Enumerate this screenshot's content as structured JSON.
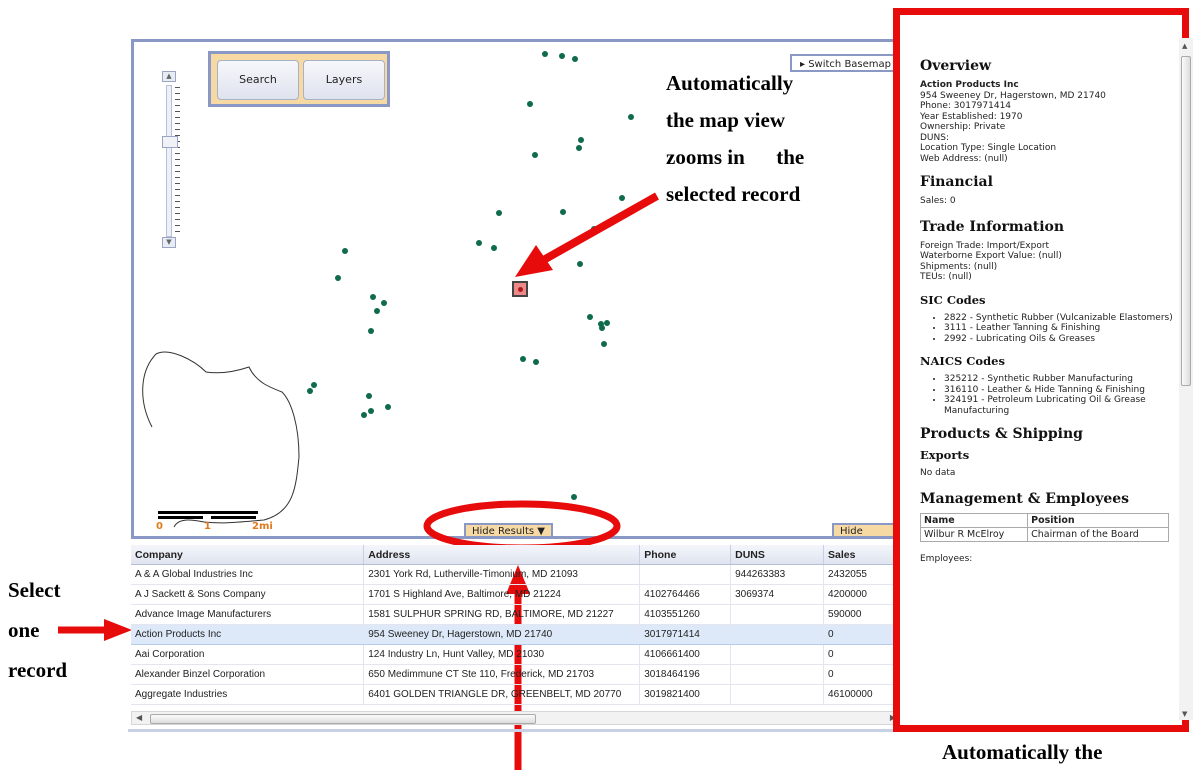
{
  "map": {
    "search_label": "Search",
    "layers_label": "Layers",
    "switch_basemap_label": "▸ Switch Basemap",
    "hide_results_label": "Hide Results ▼",
    "hide_details_label": "Hide Details",
    "scale_labels": [
      "0",
      "1",
      "2mi"
    ],
    "zoom_up": "▲",
    "zoom_down": "▼"
  },
  "annotations": {
    "zoom_note": [
      "Automatically",
      "the map view",
      "zooms in      the",
      "selected record"
    ],
    "select_note": [
      "Select",
      "one",
      "record"
    ],
    "details_note": "Automatically the"
  },
  "results": {
    "columns": [
      "Company",
      "Address",
      "Phone",
      "DUNS",
      "Sales"
    ],
    "rows": [
      [
        "A & A Global Industries Inc",
        "2301 York Rd, Lutherville-Timonium, MD 21093",
        "",
        "944263383",
        "2432055"
      ],
      [
        "A J Sackett & Sons Company",
        "1701 S Highland Ave, Baltimore, MD 21224",
        "4102764466",
        "3069374",
        "4200000"
      ],
      [
        "Advance Image Manufacturers",
        "1581 SULPHUR SPRING RD, BALTIMORE, MD 21227",
        "4103551260",
        "",
        "590000"
      ],
      [
        "Action Products Inc",
        "954 Sweeney Dr, Hagerstown, MD 21740",
        "3017971414",
        "",
        "0"
      ],
      [
        "Aai Corporation",
        "124 Industry Ln, Hunt Valley, MD 21030",
        "4106661400",
        "",
        "0"
      ],
      [
        "Alexander Binzel Corporation",
        "650 Medimmune CT Ste 110, Frederick, MD 21703",
        "3018464196",
        "",
        "0"
      ],
      [
        "Aggregate Industries",
        "6401 GOLDEN TRIANGLE DR, GREENBELT, MD 20770",
        "3019821400",
        "",
        "46100000"
      ]
    ],
    "selected_index": 3
  },
  "details": {
    "overview_title": "Overview",
    "company": "Action Products Inc",
    "overview_lines": [
      "954 Sweeney Dr, Hagerstown, MD 21740",
      "Phone: 3017971414",
      "Year Established: 1970",
      "Ownership: Private",
      "DUNS:",
      "Location Type: Single Location",
      "Web Address: (null)"
    ],
    "financial_title": "Financial",
    "sales": "Sales: 0",
    "trade_title": "Trade Information",
    "trade_lines": [
      "Foreign Trade: Import/Export",
      "Waterborne Export Value: (null)",
      "Shipments: (null)",
      "TEUs: (null)"
    ],
    "sic_title": "SIC Codes",
    "sic_items": [
      "2822 - Synthetic Rubber (Vulcanizable Elastomers)",
      "3111 - Leather Tanning & Finishing",
      "2992 - Lubricating Oils & Greases"
    ],
    "naics_title": "NAICS Codes",
    "naics_items": [
      "325212 - Synthetic Rubber Manufacturing",
      "316110 - Leather & Hide Tanning & Finishing",
      "324191 - Petroleum Lubricating Oil & Grease Manufacturing"
    ],
    "products_title": "Products & Shipping",
    "exports_title": "Exports",
    "exports_value": "No data",
    "management_title": "Management & Employees",
    "mgmt_columns": [
      "Name",
      "Position"
    ],
    "mgmt_rows": [
      [
        "Wilbur R McElroy",
        "Chairman of the Board"
      ]
    ],
    "employees": "Employees:"
  },
  "colors": {
    "highlight_red": "#e80b0b",
    "map_border": "#8a98c6",
    "button_tan": "#f7d9a3",
    "marker_green": "#0f6b4b"
  }
}
